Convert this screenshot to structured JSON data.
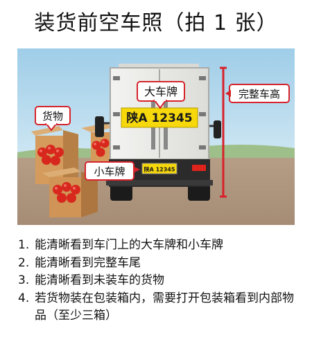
{
  "title": "装货前空车照（拍 1 张）",
  "illustration": {
    "label_big_plate": "大车牌",
    "label_height": "完整车高",
    "label_cargo": "货物",
    "label_small_plate": "小车牌",
    "big_plate_text": "陕A 12345",
    "small_plate_text": "陕A 12345",
    "colors": {
      "sky": "#a9d3ea",
      "ground": "#bca58f",
      "plate": "#f6d80b",
      "height_bar": "#d6222a",
      "callout_border": "#d6222a"
    }
  },
  "instructions": [
    {
      "num": "1.",
      "text": "能清晰看到车门上的大车牌和小车牌"
    },
    {
      "num": "2.",
      "text": "能清晰看到完整车尾"
    },
    {
      "num": "3.",
      "text": "能清晰看到未装车的货物"
    },
    {
      "num": "4.",
      "text": "若货物装在包装箱内，需要打开包装箱看到内部物品（至少三箱）"
    }
  ]
}
